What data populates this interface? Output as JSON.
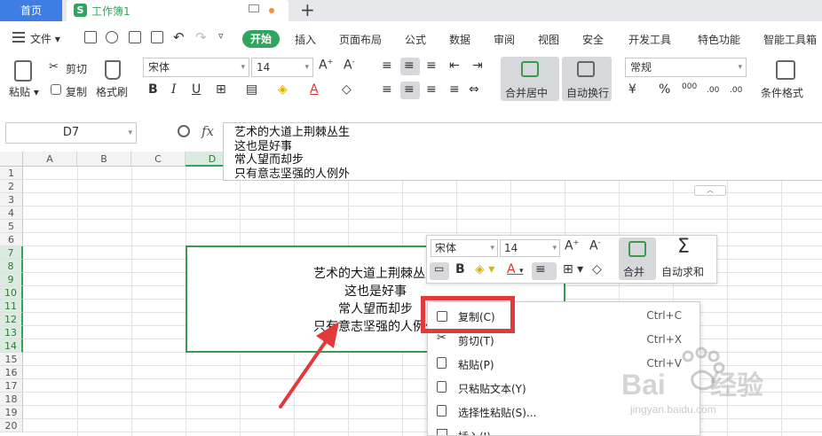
{
  "titlebar": {
    "home_tab": "首页",
    "workbook_tab": "工作簿1",
    "workbook_logo": "S",
    "new_tab": "+"
  },
  "menubar": {
    "file": "文件",
    "start": "开始",
    "items": [
      "插入",
      "页面布局",
      "公式",
      "数据",
      "审阅",
      "视图",
      "安全",
      "开发工具",
      "特色功能",
      "智能工具箱"
    ]
  },
  "ribbon": {
    "paste": "粘贴",
    "cut": "剪切",
    "copy": "复制",
    "format_painter": "格式刷",
    "font_name": "宋体",
    "font_size": "14",
    "merge_center": "合并居中",
    "wrap_text": "自动换行",
    "number_format": "常规",
    "conditional_format": "条件格式",
    "percent": "%",
    "thousands": "000",
    "inc_decimal": ".00",
    "dec_decimal": ".00"
  },
  "formula_bar": {
    "name_box": "D7",
    "fx": "fx",
    "content_lines": [
      "艺术的大道上荆棘丛生",
      "这也是好事",
      "常人望而却步",
      "只有意志坚强的人例外"
    ]
  },
  "grid": {
    "columns": [
      "A",
      "B",
      "C",
      "D"
    ],
    "rows": [
      "1",
      "2",
      "3",
      "4",
      "5",
      "6",
      "7",
      "8",
      "9",
      "10",
      "11",
      "12",
      "13",
      "14",
      "15",
      "16",
      "17",
      "18",
      "19",
      "20"
    ]
  },
  "cell": {
    "lines": [
      "艺术的大道上荆棘丛生",
      "这也是好事",
      "常人望而却步",
      "只有意志坚强的人例外"
    ]
  },
  "mini_toolbar": {
    "font_name": "宋体",
    "font_size": "14",
    "merge": "合并",
    "autosum": "自动求和"
  },
  "context_menu": {
    "items": [
      {
        "label": "复制(C)",
        "shortcut": "Ctrl+C",
        "icon": "copy-icon"
      },
      {
        "label": "剪切(T)",
        "shortcut": "Ctrl+X",
        "icon": "scissors-icon"
      },
      {
        "label": "粘贴(P)",
        "shortcut": "Ctrl+V",
        "icon": "paste-icon"
      },
      {
        "label": "只粘贴文本(Y)",
        "shortcut": "",
        "icon": "paste-text-icon"
      },
      {
        "label": "选择性粘贴(S)...",
        "shortcut": "",
        "icon": "paste-special-icon"
      },
      {
        "label": "插入(I)",
        "shortcut": "",
        "icon": "insert-icon"
      }
    ]
  },
  "colors": {
    "accent_green": "#2fa55e",
    "home_blue": "#3e7de3",
    "highlight_red": "#e23a3a"
  }
}
